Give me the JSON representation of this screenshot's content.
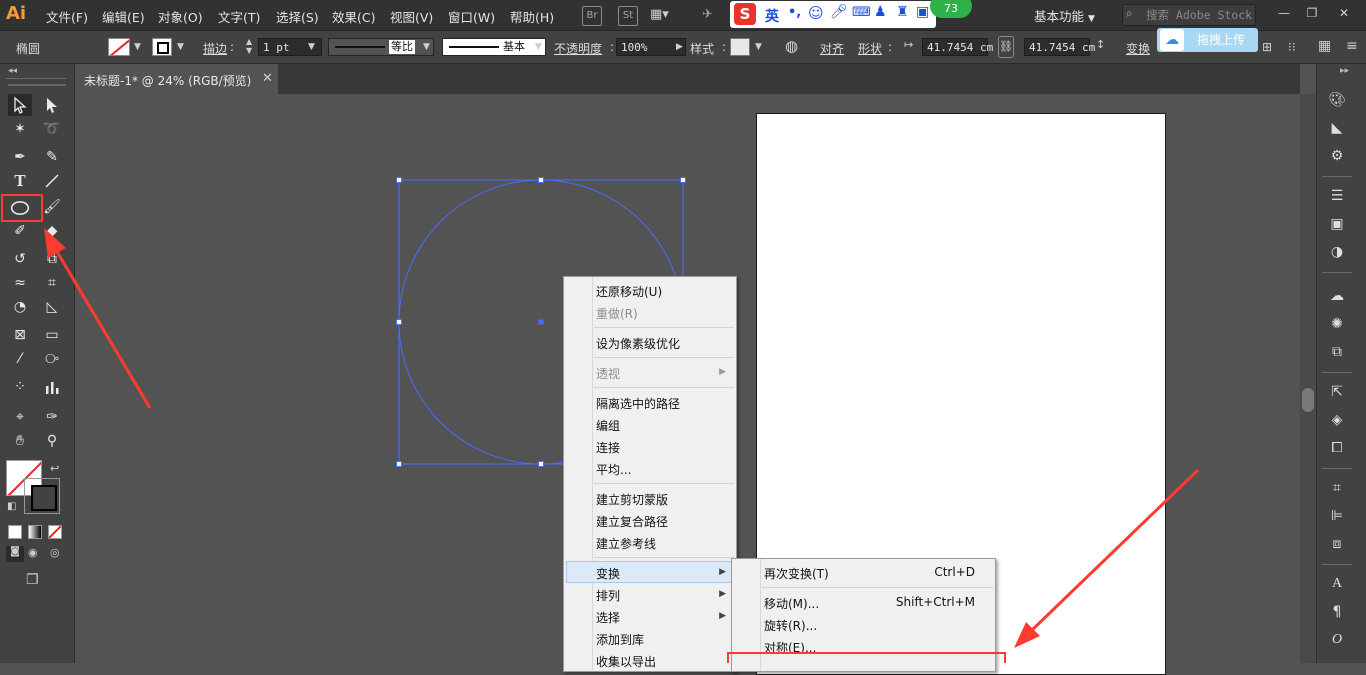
{
  "app": {
    "logo": "Ai"
  },
  "menubar": {
    "items": [
      "文件(F)",
      "编辑(E)",
      "对象(O)",
      "文字(T)",
      "选择(S)",
      "效果(C)",
      "视图(V)",
      "窗口(W)",
      "帮助(H)"
    ],
    "bridge_label": "Br",
    "stock_label": "St",
    "workspace": "基本功能",
    "search_placeholder": "搜索 Adobe Stock",
    "ime_label": "英",
    "ime_badge": "73"
  },
  "controlbar": {
    "tool_name": "椭圆",
    "stroke_label": "描边",
    "stroke_weight": "1 pt",
    "profile1": "等比",
    "profile2": "基本",
    "opacity_label": "不透明度",
    "opacity_value": "100%",
    "style_label": "样式",
    "align_label": "对齐",
    "shape_label": "形状",
    "width_value": "41.7454 cm",
    "height_value": "41.7454 cm",
    "transform_label": "变换",
    "upload_label": "拖拽上传"
  },
  "document": {
    "tab_title": "未标题-1* @ 24% (RGB/预览)"
  },
  "context_menu": {
    "items": [
      {
        "label": "还原移动(U)",
        "disabled": false
      },
      {
        "label": "重做(R)",
        "disabled": true
      },
      {
        "label": "设为像素级优化",
        "disabled": false
      },
      {
        "label": "透视",
        "disabled": true,
        "submenu": true
      },
      {
        "label": "隔离选中的路径",
        "disabled": false
      },
      {
        "label": "编组",
        "disabled": false
      },
      {
        "label": "连接",
        "disabled": false
      },
      {
        "label": "平均...",
        "disabled": false
      },
      {
        "label": "建立剪切蒙版",
        "disabled": false
      },
      {
        "label": "建立复合路径",
        "disabled": false
      },
      {
        "label": "建立参考线",
        "disabled": false
      },
      {
        "label": "变换",
        "disabled": false,
        "submenu": true,
        "highlighted": true
      },
      {
        "label": "排列",
        "disabled": false,
        "submenu": true
      },
      {
        "label": "选择",
        "disabled": false,
        "submenu": true
      },
      {
        "label": "添加到库",
        "disabled": false
      },
      {
        "label": "收集以导出",
        "disabled": false
      }
    ]
  },
  "submenu": {
    "items": [
      {
        "label": "再次变换(T)",
        "shortcut": "Ctrl+D"
      },
      {
        "label": "移动(M)...",
        "shortcut": "Shift+Ctrl+M"
      },
      {
        "label": "旋转(R)...",
        "shortcut": ""
      },
      {
        "label": "对称(E)...",
        "shortcut": ""
      }
    ]
  },
  "annotations": {
    "color": "#ff3b30"
  },
  "colors": {
    "selection": "#4a6cff",
    "menubar": "#323232",
    "panel": "#424242",
    "canvas": "#535353"
  }
}
